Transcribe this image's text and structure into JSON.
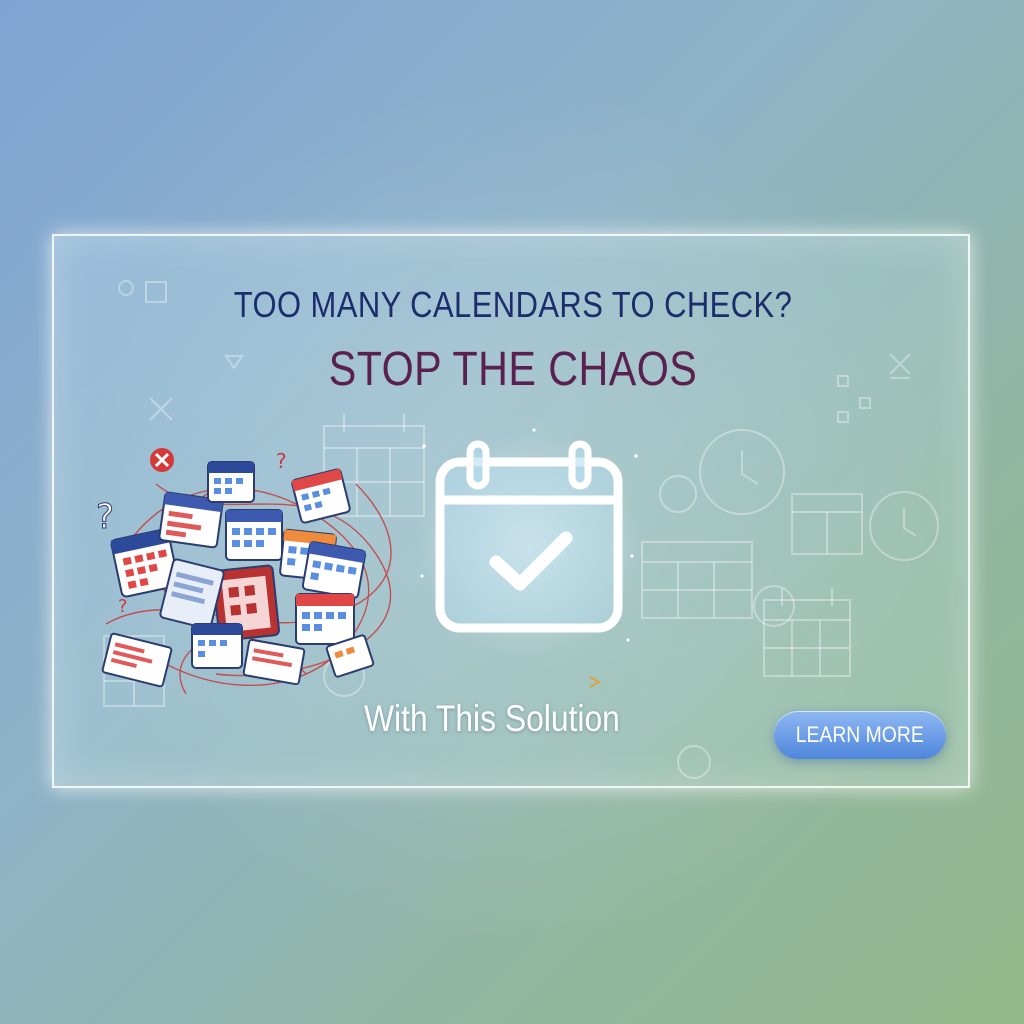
{
  "banner": {
    "headline": "TOO MANY CALENDARS TO CHECK?",
    "subheadline": "STOP THE CHAOS",
    "solution_text": "With This Solution",
    "cta_label": "LEARN MORE"
  },
  "icons": [
    "cluttered-calendars-illustration",
    "calendar-check-icon",
    "arrow-right-icon",
    "clock-icon",
    "question-mark-icon",
    "close-icon"
  ],
  "colors": {
    "headline": "#1c2d6b",
    "subheadline": "#5a2150",
    "cta": "#4f86dc",
    "accent_red": "#d43a3a"
  }
}
